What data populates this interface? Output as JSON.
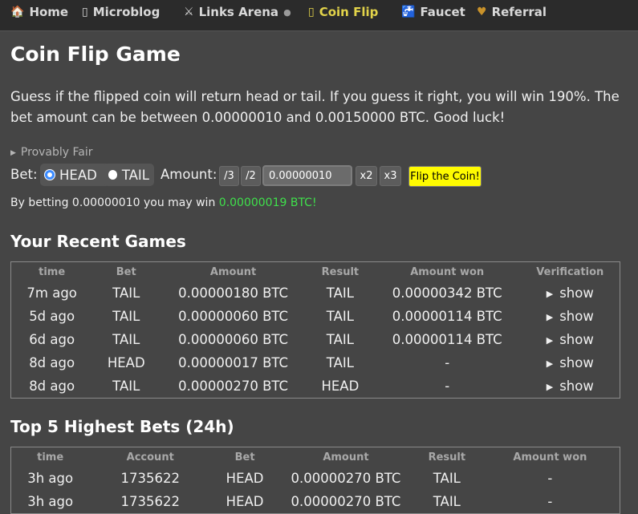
{
  "nav": {
    "items": [
      {
        "label": "Home",
        "icon": "home-icon",
        "glyph": "🏠"
      },
      {
        "label": "Microblog",
        "icon": "microblog-icon",
        "glyph": "▯"
      },
      {
        "label": "Links Arena",
        "icon": "swords-icon",
        "glyph": "⚔",
        "dot": "●"
      },
      {
        "label": "Coin Flip",
        "icon": "coin-icon",
        "glyph": "▯"
      },
      {
        "label": "Faucet",
        "icon": "faucet-icon",
        "glyph": "🚰"
      },
      {
        "label": "Referral",
        "icon": "heart-hands-icon",
        "glyph": "♥"
      }
    ]
  },
  "page": {
    "title": "Coin Flip Game",
    "description": "Guess if the flipped coin will return head or tail. If you guess it right, you will win 190%. The bet amount can be between 0.00000010 and 0.00150000 BTC. Good luck!",
    "provably_fair": "Provably Fair"
  },
  "bet": {
    "bet_label": "Bet:",
    "head_label": "HEAD",
    "tail_label": "TAIL",
    "selected": "HEAD",
    "amount_label": "Amount:",
    "div3": "/3",
    "div2": "/2",
    "amount_value": "0.00000010",
    "mul2": "x2",
    "mul3": "x3",
    "flip_label": "Flip the Coin!",
    "win_prefix": "By betting 0.00000010 you may win ",
    "win_amount": "0.00000019 BTC!"
  },
  "recent": {
    "title": "Your Recent Games",
    "headers": [
      "time",
      "Bet",
      "Amount",
      "Result",
      "Amount won",
      "Verification"
    ],
    "rows": [
      [
        "7m ago",
        "TAIL",
        "0.00000180 BTC",
        "TAIL",
        "0.00000342 BTC",
        "show"
      ],
      [
        "5d ago",
        "TAIL",
        "0.00000060 BTC",
        "TAIL",
        "0.00000114 BTC",
        "show"
      ],
      [
        "6d ago",
        "TAIL",
        "0.00000060 BTC",
        "TAIL",
        "0.00000114 BTC",
        "show"
      ],
      [
        "8d ago",
        "HEAD",
        "0.00000017 BTC",
        "TAIL",
        "-",
        "show"
      ],
      [
        "8d ago",
        "TAIL",
        "0.00000270 BTC",
        "HEAD",
        "-",
        "show"
      ]
    ]
  },
  "top": {
    "title": "Top 5 Highest Bets (24h)",
    "headers": [
      "time",
      "Account",
      "Bet",
      "Amount",
      "Result",
      "Amount won"
    ],
    "rows": [
      [
        "3h ago",
        "1735622",
        "HEAD",
        "0.00000270 BTC",
        "TAIL",
        "-"
      ],
      [
        "3h ago",
        "1735622",
        "HEAD",
        "0.00000270 BTC",
        "TAIL",
        "-"
      ]
    ]
  },
  "colors": {
    "background": "#454545",
    "nav": "#2b2b2b",
    "active_nav": "#e2d34a",
    "win_green": "#3fe04b",
    "flip_button": "#fffb00"
  }
}
